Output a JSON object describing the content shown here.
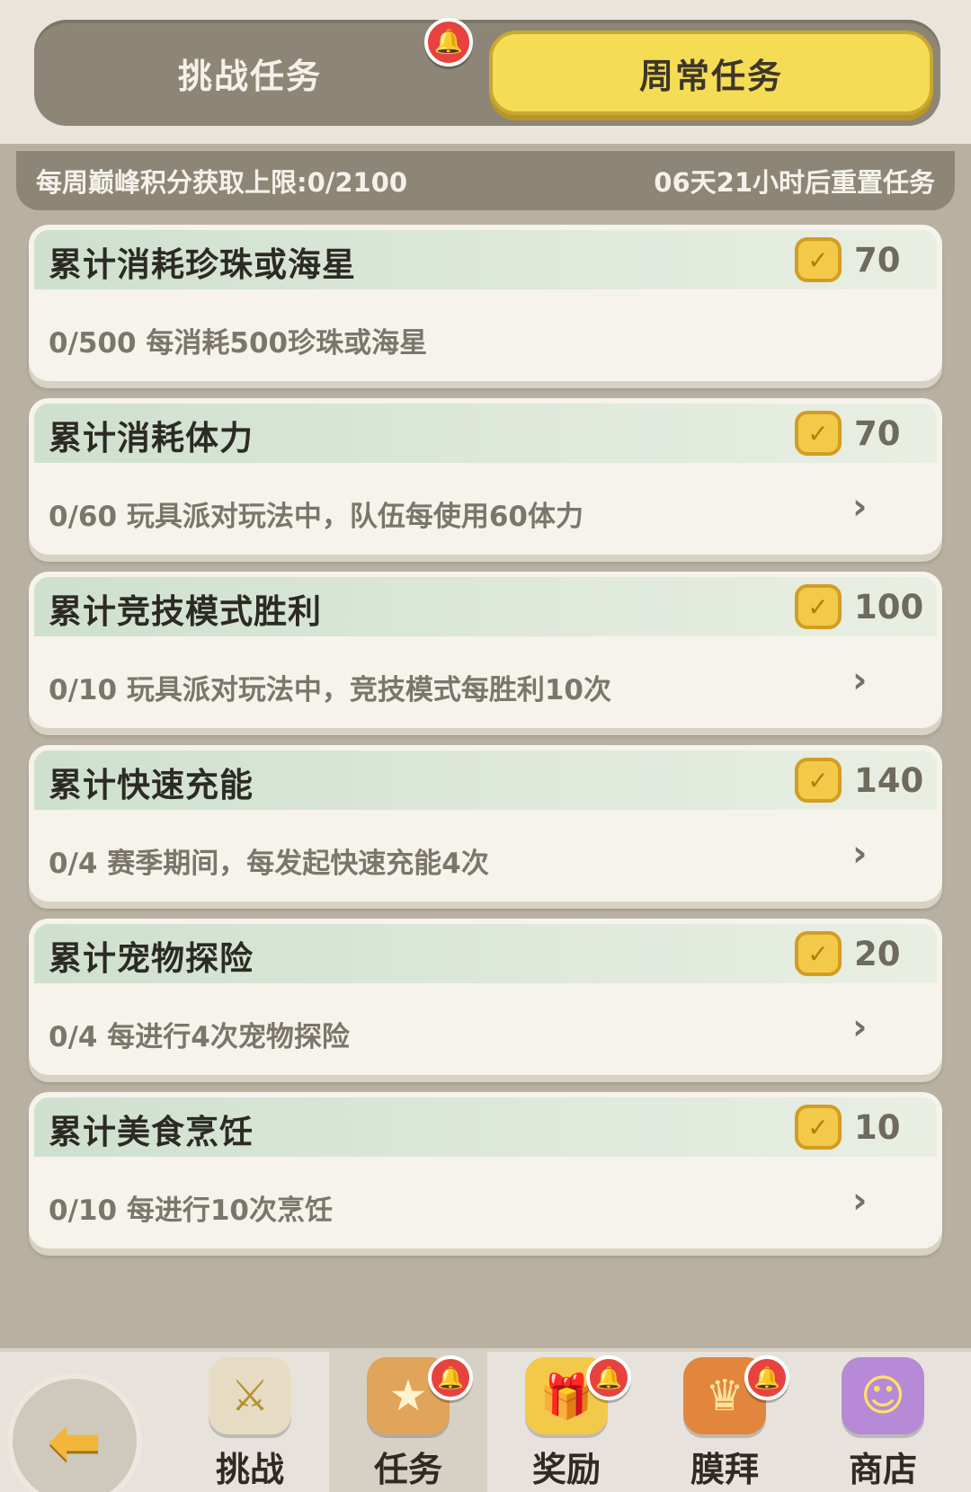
{
  "tabs": {
    "challenge_label": "挑战任务",
    "weekly_label": "周常任务"
  },
  "info": {
    "weekly_limit": "每周巅峰积分获取上限:0/2100",
    "reset_timer": "06天21小时后重置任务"
  },
  "tasks": [
    {
      "title": "累计消耗珍珠或海星",
      "reward": "70",
      "desc": "0/500 每消耗500珍珠或海星",
      "has_arrow": false
    },
    {
      "title": "累计消耗体力",
      "reward": "70",
      "desc": "0/60 玩具派对玩法中，队伍每使用60体力",
      "has_arrow": true
    },
    {
      "title": "累计竞技模式胜利",
      "reward": "100",
      "desc": "0/10 玩具派对玩法中，竞技模式每胜利10次",
      "has_arrow": true
    },
    {
      "title": "累计快速充能",
      "reward": "140",
      "desc": "0/4 赛季期间，每发起快速充能4次",
      "has_arrow": true
    },
    {
      "title": "累计宠物探险",
      "reward": "20",
      "desc": "0/4 每进行4次宠物探险",
      "has_arrow": true
    },
    {
      "title": "累计美食烹饪",
      "reward": "10",
      "desc": "0/10 每进行10次烹饪",
      "has_arrow": true
    }
  ],
  "icons": {
    "bell": "bell-icon",
    "reward": "peak-badge-icon",
    "chevron": "chevron-right-icon",
    "back": "back-arrow-icon"
  },
  "nav": {
    "challenge": "挑战",
    "tasks": "任务",
    "rewards": "奖励",
    "worship": "膜拜",
    "shop": "商店"
  },
  "colors": {
    "accent_yellow": "#f5dc55",
    "header_green": "#cfe0cf",
    "notification_red": "#e8423f"
  }
}
